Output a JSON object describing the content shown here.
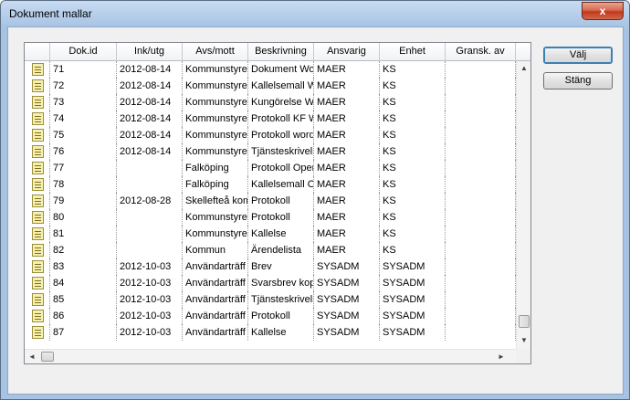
{
  "window": {
    "title": "Dokument mallar",
    "close_glyph": "x"
  },
  "table": {
    "columns": [
      "",
      "Dok.id",
      "Ink/utg",
      "Avs/mott",
      "Beskrivning",
      "Ansvarig",
      "Enhet",
      "Gransk. av"
    ],
    "rows": [
      [
        "71",
        "2012-08-14",
        "Kommunstyrelsen",
        "Dokument Word",
        "MAER",
        "KS",
        ""
      ],
      [
        "72",
        "2012-08-14",
        "Kommunstyrelsen",
        "Kallelsemall Word",
        "MAER",
        "KS",
        ""
      ],
      [
        "73",
        "2012-08-14",
        "Kommunstyrelsen",
        "Kungörelse Word",
        "MAER",
        "KS",
        ""
      ],
      [
        "74",
        "2012-08-14",
        "Kommunstyrelsen",
        "Protokoll KF Word",
        "MAER",
        "KS",
        ""
      ],
      [
        "75",
        "2012-08-14",
        "Kommunstyrelsen",
        "Protokoll word",
        "MAER",
        "KS",
        ""
      ],
      [
        "76",
        "2012-08-14",
        "Kommunstyrelsen",
        "Tjänsteskrivelse",
        "MAER",
        "KS",
        ""
      ],
      [
        "77",
        "",
        "Falköping",
        "Protokoll OpenOffice",
        "MAER",
        "KS",
        ""
      ],
      [
        "78",
        "",
        "Falköping",
        "Kallelsemall OpenOffice",
        "MAER",
        "KS",
        ""
      ],
      [
        "79",
        "2012-08-28",
        "Skellefteå kommun",
        "Protokoll",
        "MAER",
        "KS",
        ""
      ],
      [
        "80",
        "",
        "Kommunstyrelsen",
        "Protokoll",
        "MAER",
        "KS",
        ""
      ],
      [
        "81",
        "",
        "Kommunstyrelsen",
        "Kallelse",
        "MAER",
        "KS",
        ""
      ],
      [
        "82",
        "",
        "Kommun",
        "Ärendelista",
        "MAER",
        "KS",
        ""
      ],
      [
        "83",
        "2012-10-03",
        "Användarträff",
        "Brev",
        "SYSADM",
        "SYSADM",
        ""
      ],
      [
        "84",
        "2012-10-03",
        "Användarträff",
        "Svarsbrev kopia",
        "SYSADM",
        "SYSADM",
        ""
      ],
      [
        "85",
        "2012-10-03",
        "Användarträff",
        "Tjänsteskrivelse",
        "SYSADM",
        "SYSADM",
        ""
      ],
      [
        "86",
        "2012-10-03",
        "Användarträff",
        "Protokoll",
        "SYSADM",
        "SYSADM",
        ""
      ],
      [
        "87",
        "2012-10-03",
        "Användarträff",
        "Kallelse",
        "SYSADM",
        "SYSADM",
        ""
      ]
    ]
  },
  "buttons": {
    "select": "Välj",
    "close": "Stäng"
  },
  "scroll": {
    "up": "▲",
    "down": "▼",
    "left": "◄",
    "right": "►"
  }
}
